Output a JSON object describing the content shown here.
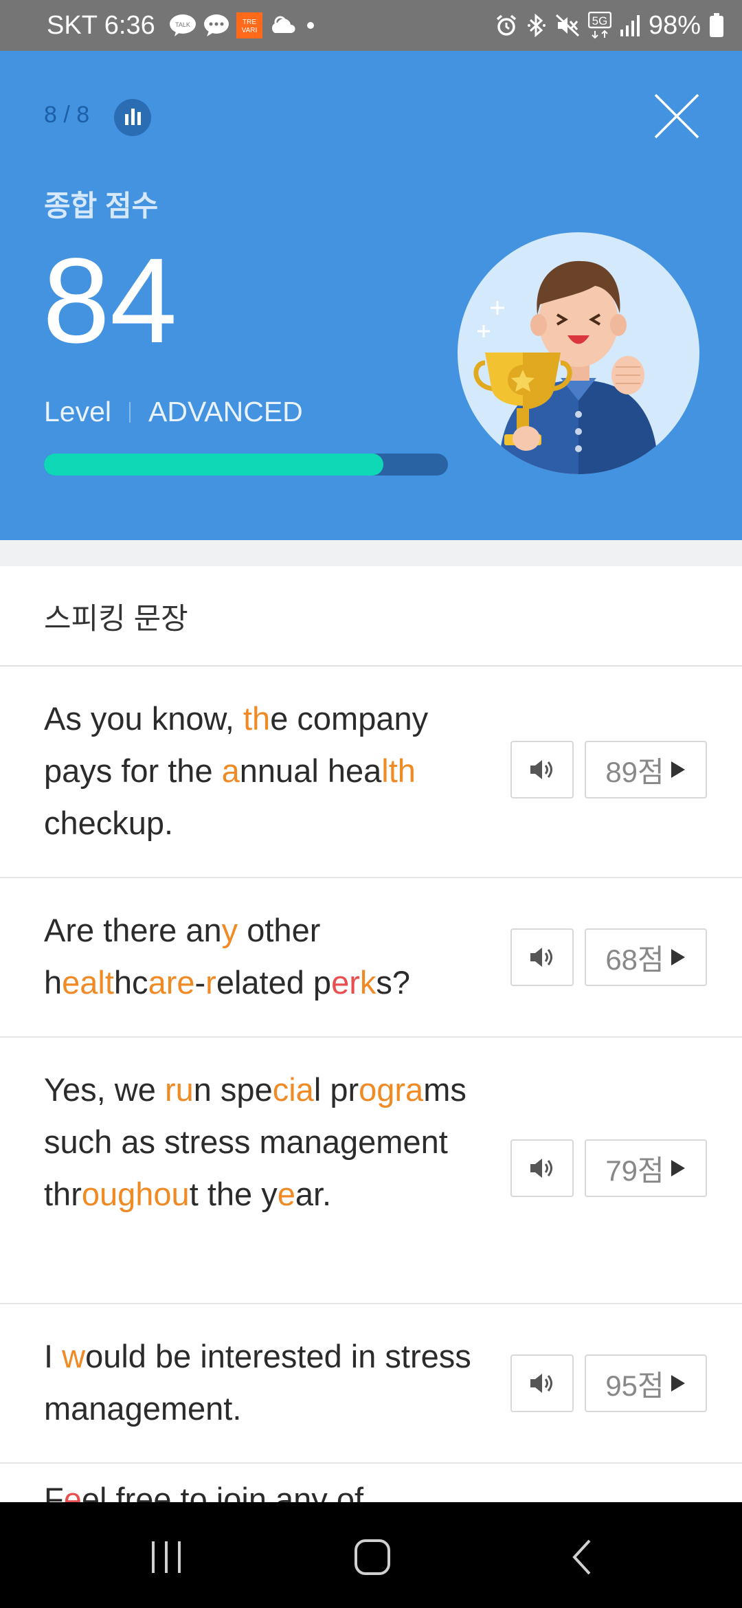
{
  "status_bar": {
    "carrier": "SKT",
    "time": "6:36",
    "left_icons": [
      "kakaotalk-icon",
      "message-icon",
      "trevari-icon",
      "weather-icon",
      "dot-icon"
    ],
    "right_icons": [
      "alarm-icon",
      "bluetooth-icon",
      "mute-icon",
      "5g-icon",
      "signal-icon"
    ],
    "battery": "98%"
  },
  "header": {
    "progress": "8 / 8",
    "score_label": "종합 점수",
    "score": "84",
    "level_label": "Level",
    "level_value": "ADVANCED",
    "level_progress": 0.84,
    "colors": {
      "background": "#4393e1",
      "bar_fill": "#0fd8b7",
      "bar_track": "#2a63a4"
    }
  },
  "section": {
    "title": "스피킹 문장"
  },
  "sentences": [
    {
      "text": "As you know, the company pays for the annual health checkup.",
      "score": "89점"
    },
    {
      "text": "Are there any other healthcare-related perks?",
      "score": "68점"
    },
    {
      "text": "Yes, we run special programs such as stress management throughout the year.",
      "score": "79점"
    },
    {
      "text": "I would be interested in stress management.",
      "score": "95점"
    }
  ],
  "partial_text": "Feel free to join any of",
  "colors": {
    "highlight_orange": "#f08a24",
    "highlight_red": "#e84e4e"
  },
  "nav": {
    "buttons": [
      "recent-apps",
      "home",
      "back"
    ]
  }
}
